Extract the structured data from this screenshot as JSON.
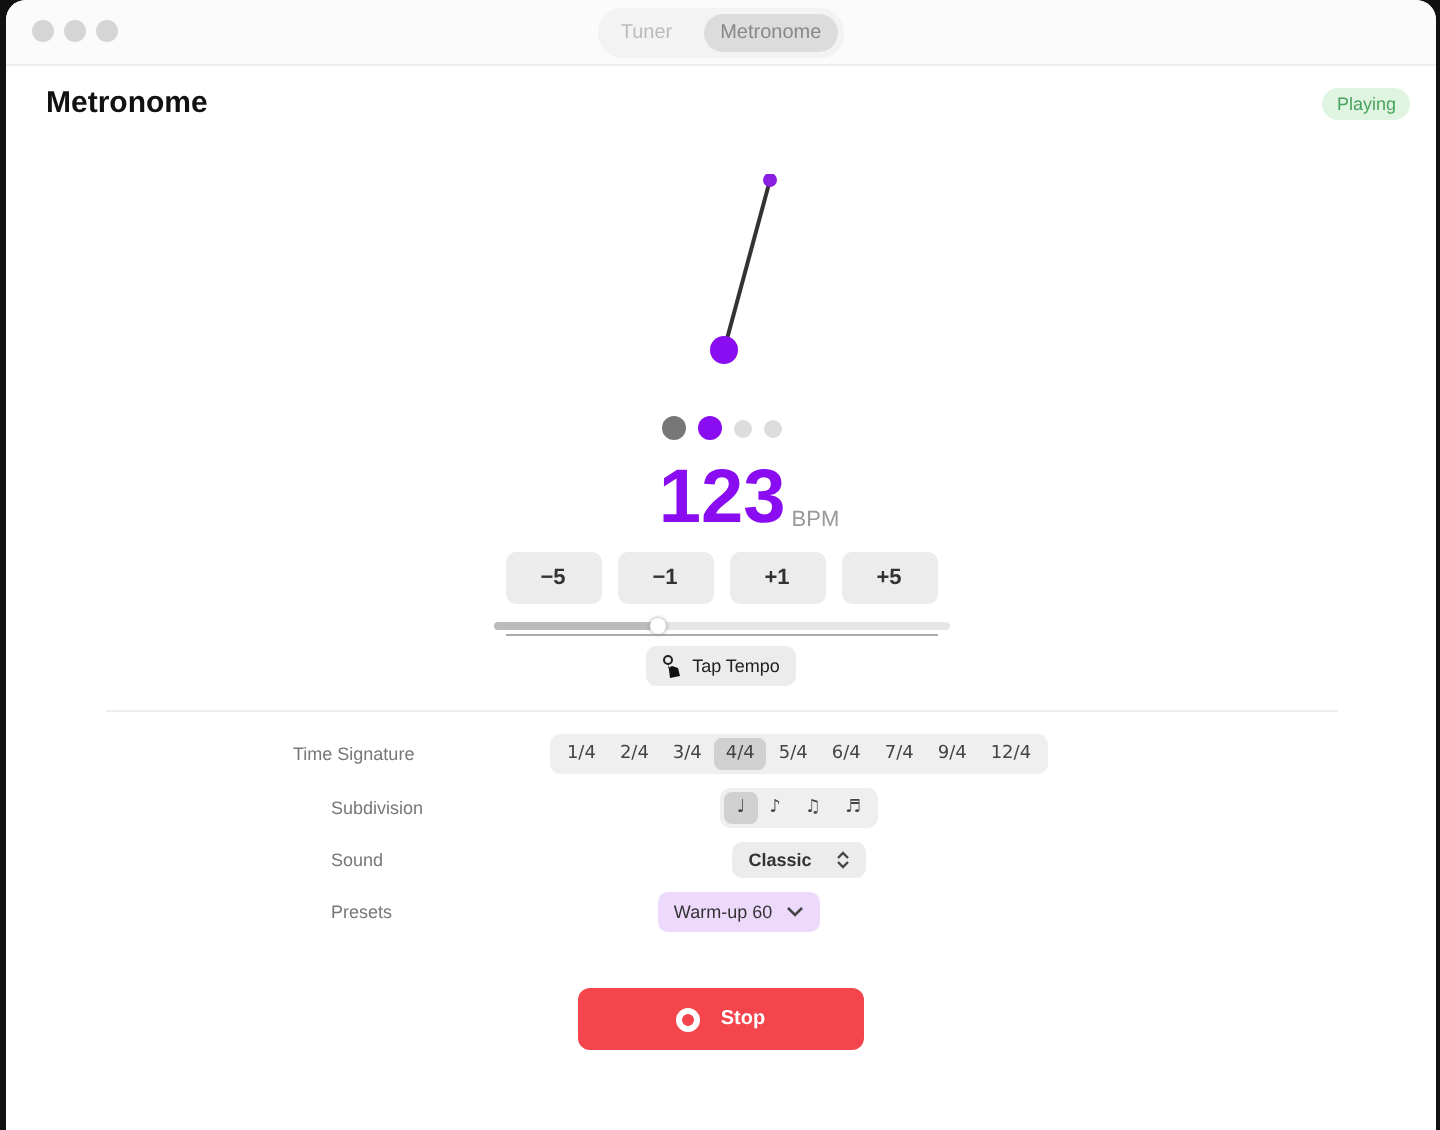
{
  "tabs": [
    {
      "label": "Tuner",
      "selected": false
    },
    {
      "label": "Metronome",
      "selected": true
    }
  ],
  "header": {
    "title": "Metronome",
    "status": "Playing"
  },
  "beats": [
    {
      "kind": "played"
    },
    {
      "kind": "current"
    },
    {
      "kind": "upcoming"
    },
    {
      "kind": "upcoming"
    }
  ],
  "tempo": {
    "value": "123",
    "unit": "BPM"
  },
  "steps": [
    "−5",
    "−1",
    "+1",
    "+5"
  ],
  "slider": {
    "level": 0.36
  },
  "tap_button": "Tap Tempo",
  "settings": [
    {
      "kind": "segments",
      "label": "Time Signature",
      "options": [
        {
          "label": "1/4",
          "selected": false
        },
        {
          "label": "2/4",
          "selected": false
        },
        {
          "label": "3/4",
          "selected": false
        },
        {
          "label": "4/4",
          "selected": true
        },
        {
          "label": "5/4",
          "selected": false
        },
        {
          "label": "6/4",
          "selected": false
        },
        {
          "label": "7/4",
          "selected": false
        },
        {
          "label": "9/4",
          "selected": false
        },
        {
          "label": "12/4",
          "selected": false
        }
      ]
    },
    {
      "kind": "segments",
      "label": "Subdivision",
      "options": [
        {
          "label": "♩",
          "selected": true
        },
        {
          "label": "♪",
          "selected": false
        },
        {
          "label": "♫",
          "selected": false
        },
        {
          "label": "♬",
          "selected": false
        }
      ]
    },
    {
      "kind": "popup",
      "label": "Sound",
      "value": "Classic"
    },
    {
      "kind": "menu",
      "label": "Presets",
      "value": "Warm-up 60"
    }
  ],
  "stop_button": "Stop"
}
